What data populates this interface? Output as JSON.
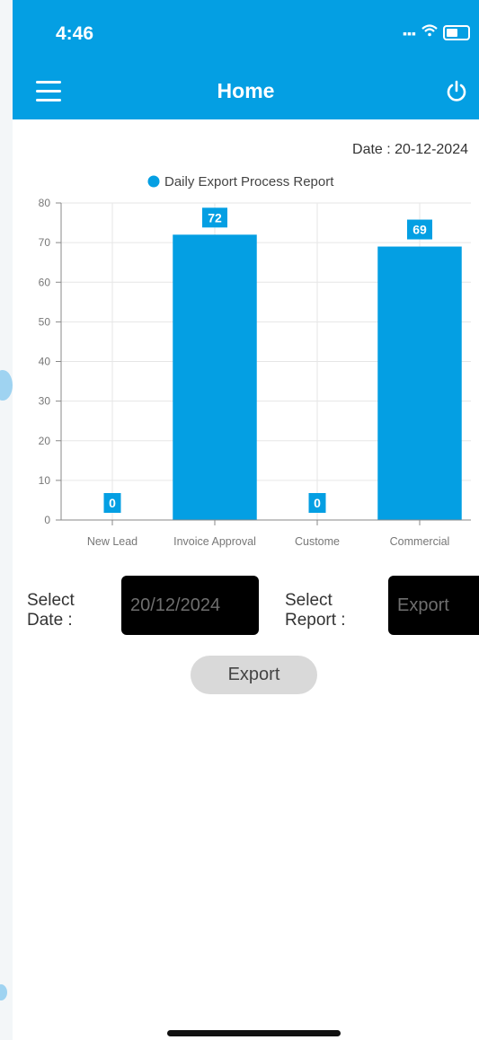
{
  "status_bar": {
    "time": "4:46",
    "signal_icon": "signal-icon",
    "wifi_icon": "wifi-icon",
    "battery_icon": "battery-icon"
  },
  "header": {
    "title": "Home",
    "menu_icon": "hamburger-menu-icon",
    "power_icon": "power-icon"
  },
  "date_label": "Date : 20-12-2024",
  "colors": {
    "primary": "#049fe3",
    "input_bg": "#000000",
    "button_bg": "#d9d9d9"
  },
  "chart_data": {
    "type": "bar",
    "categories": [
      "New Lead",
      "Invoice Approval",
      "Custome",
      "Commercial"
    ],
    "series": [
      {
        "name": "Daily Export Process Report",
        "values": [
          0,
          72,
          0,
          69
        ]
      }
    ],
    "ylim": [
      0,
      80
    ],
    "yticks": [
      0,
      10,
      20,
      30,
      40,
      50,
      60,
      70,
      80
    ],
    "grid": true,
    "legend": "top"
  },
  "form": {
    "select_date_label": "Select Date :",
    "date_value": "20/12/2024",
    "select_report_label": "Select Report :",
    "report_value": "Export",
    "export_button_label": "Export"
  }
}
